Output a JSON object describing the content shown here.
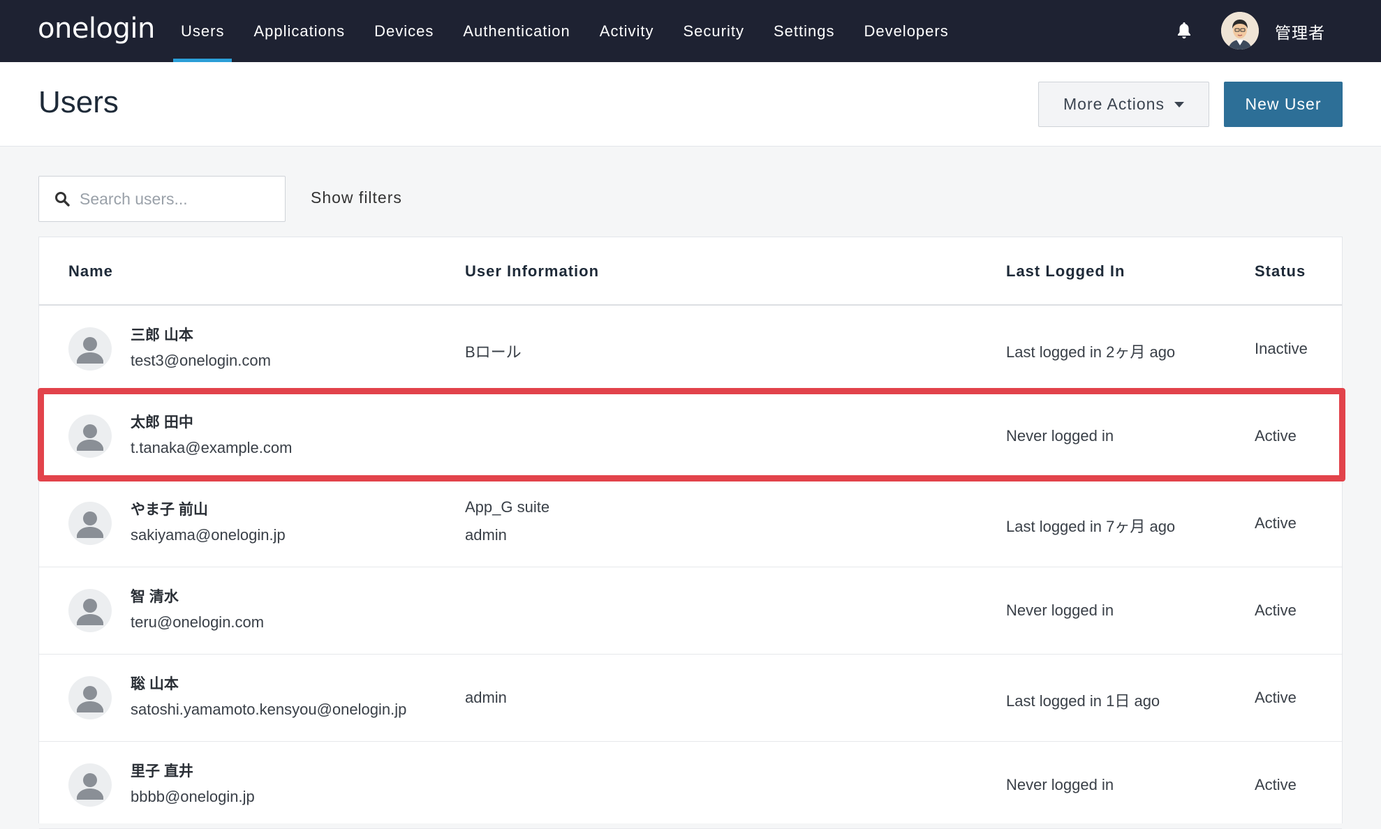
{
  "brand": {
    "logo_text": "onelogin"
  },
  "nav": {
    "items": [
      {
        "label": "Users",
        "active": true
      },
      {
        "label": "Applications"
      },
      {
        "label": "Devices"
      },
      {
        "label": "Authentication"
      },
      {
        "label": "Activity"
      },
      {
        "label": "Security"
      },
      {
        "label": "Settings"
      },
      {
        "label": "Developers"
      }
    ],
    "user_name": "管理者"
  },
  "header": {
    "title": "Users",
    "more_actions_label": "More Actions",
    "new_user_label": "New User"
  },
  "search": {
    "placeholder": "Search users...",
    "value": "",
    "show_filters_label": "Show filters"
  },
  "table": {
    "columns": {
      "name": "Name",
      "info": "User Information",
      "last_login": "Last Logged In",
      "status": "Status"
    },
    "rows": [
      {
        "name": "三郎 山本",
        "email": "test3@onelogin.com",
        "info": [
          "Bロール"
        ],
        "last_login": "Last logged in 2ヶ月 ago",
        "status": "Inactive"
      },
      {
        "name": "太郎 田中",
        "email": "t.tanaka@example.com",
        "info": [],
        "last_login": "Never logged in",
        "status": "Active"
      },
      {
        "name": "やま子 前山",
        "email": "sakiyama@onelogin.jp",
        "info": [
          "App_G suite",
          "admin"
        ],
        "last_login": "Last logged in 7ヶ月 ago",
        "status": "Active"
      },
      {
        "name": "智 清水",
        "email": "teru@onelogin.com",
        "info": [],
        "last_login": "Never logged in",
        "status": "Active"
      },
      {
        "name": "聡 山本",
        "email": "satoshi.yamamoto.kensyou@onelogin.jp",
        "info": [
          "admin"
        ],
        "last_login": "Last logged in 1日 ago",
        "status": "Active"
      },
      {
        "name": "里子 直井",
        "email": "bbbb@onelogin.jp",
        "info": [],
        "last_login": "Never logged in",
        "status": "Active"
      }
    ]
  },
  "colors": {
    "topbar": "#1e2232",
    "active_tab_underline": "#2b9fd8",
    "primary_button": "#2d6f97",
    "highlight_border": "#e2434b"
  }
}
